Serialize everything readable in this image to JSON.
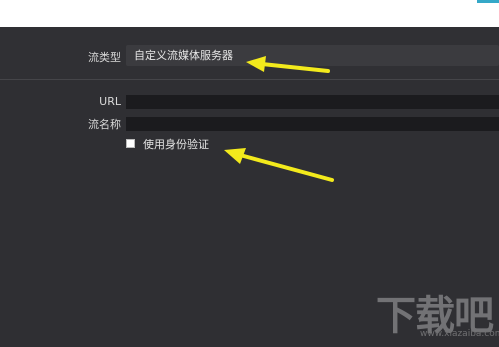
{
  "stream": {
    "type_label": "流类型",
    "type_value": "自定义流媒体服务器"
  },
  "fields": {
    "url_label": "URL",
    "url_value": "",
    "stream_name_label": "流名称",
    "stream_name_value": ""
  },
  "auth": {
    "checkbox_label": "使用身份验证",
    "checked": false
  },
  "watermark": {
    "logo_text": "下载吧",
    "url": "www.xiazaiba.com"
  },
  "colors": {
    "arrow": "#f3ea1c",
    "panel_bg": "#2f2f33",
    "field_bg": "#1b1b1e",
    "accent": "#35a8c8"
  }
}
